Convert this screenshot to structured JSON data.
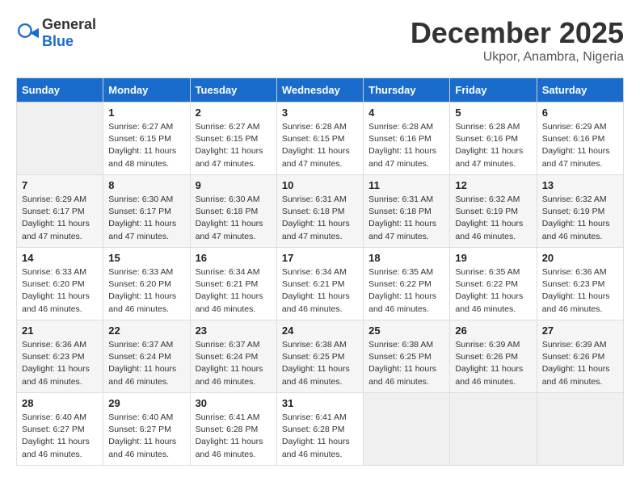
{
  "header": {
    "logo_general": "General",
    "logo_blue": "Blue",
    "month": "December 2025",
    "location": "Ukpor, Anambra, Nigeria"
  },
  "columns": [
    "Sunday",
    "Monday",
    "Tuesday",
    "Wednesday",
    "Thursday",
    "Friday",
    "Saturday"
  ],
  "weeks": [
    [
      {
        "day": "",
        "info": ""
      },
      {
        "day": "1",
        "info": "Sunrise: 6:27 AM\nSunset: 6:15 PM\nDaylight: 11 hours\nand 48 minutes."
      },
      {
        "day": "2",
        "info": "Sunrise: 6:27 AM\nSunset: 6:15 PM\nDaylight: 11 hours\nand 47 minutes."
      },
      {
        "day": "3",
        "info": "Sunrise: 6:28 AM\nSunset: 6:15 PM\nDaylight: 11 hours\nand 47 minutes."
      },
      {
        "day": "4",
        "info": "Sunrise: 6:28 AM\nSunset: 6:16 PM\nDaylight: 11 hours\nand 47 minutes."
      },
      {
        "day": "5",
        "info": "Sunrise: 6:28 AM\nSunset: 6:16 PM\nDaylight: 11 hours\nand 47 minutes."
      },
      {
        "day": "6",
        "info": "Sunrise: 6:29 AM\nSunset: 6:16 PM\nDaylight: 11 hours\nand 47 minutes."
      }
    ],
    [
      {
        "day": "7",
        "info": "Sunrise: 6:29 AM\nSunset: 6:17 PM\nDaylight: 11 hours\nand 47 minutes."
      },
      {
        "day": "8",
        "info": "Sunrise: 6:30 AM\nSunset: 6:17 PM\nDaylight: 11 hours\nand 47 minutes."
      },
      {
        "day": "9",
        "info": "Sunrise: 6:30 AM\nSunset: 6:18 PM\nDaylight: 11 hours\nand 47 minutes."
      },
      {
        "day": "10",
        "info": "Sunrise: 6:31 AM\nSunset: 6:18 PM\nDaylight: 11 hours\nand 47 minutes."
      },
      {
        "day": "11",
        "info": "Sunrise: 6:31 AM\nSunset: 6:18 PM\nDaylight: 11 hours\nand 47 minutes."
      },
      {
        "day": "12",
        "info": "Sunrise: 6:32 AM\nSunset: 6:19 PM\nDaylight: 11 hours\nand 46 minutes."
      },
      {
        "day": "13",
        "info": "Sunrise: 6:32 AM\nSunset: 6:19 PM\nDaylight: 11 hours\nand 46 minutes."
      }
    ],
    [
      {
        "day": "14",
        "info": "Sunrise: 6:33 AM\nSunset: 6:20 PM\nDaylight: 11 hours\nand 46 minutes."
      },
      {
        "day": "15",
        "info": "Sunrise: 6:33 AM\nSunset: 6:20 PM\nDaylight: 11 hours\nand 46 minutes."
      },
      {
        "day": "16",
        "info": "Sunrise: 6:34 AM\nSunset: 6:21 PM\nDaylight: 11 hours\nand 46 minutes."
      },
      {
        "day": "17",
        "info": "Sunrise: 6:34 AM\nSunset: 6:21 PM\nDaylight: 11 hours\nand 46 minutes."
      },
      {
        "day": "18",
        "info": "Sunrise: 6:35 AM\nSunset: 6:22 PM\nDaylight: 11 hours\nand 46 minutes."
      },
      {
        "day": "19",
        "info": "Sunrise: 6:35 AM\nSunset: 6:22 PM\nDaylight: 11 hours\nand 46 minutes."
      },
      {
        "day": "20",
        "info": "Sunrise: 6:36 AM\nSunset: 6:23 PM\nDaylight: 11 hours\nand 46 minutes."
      }
    ],
    [
      {
        "day": "21",
        "info": "Sunrise: 6:36 AM\nSunset: 6:23 PM\nDaylight: 11 hours\nand 46 minutes."
      },
      {
        "day": "22",
        "info": "Sunrise: 6:37 AM\nSunset: 6:24 PM\nDaylight: 11 hours\nand 46 minutes."
      },
      {
        "day": "23",
        "info": "Sunrise: 6:37 AM\nSunset: 6:24 PM\nDaylight: 11 hours\nand 46 minutes."
      },
      {
        "day": "24",
        "info": "Sunrise: 6:38 AM\nSunset: 6:25 PM\nDaylight: 11 hours\nand 46 minutes."
      },
      {
        "day": "25",
        "info": "Sunrise: 6:38 AM\nSunset: 6:25 PM\nDaylight: 11 hours\nand 46 minutes."
      },
      {
        "day": "26",
        "info": "Sunrise: 6:39 AM\nSunset: 6:26 PM\nDaylight: 11 hours\nand 46 minutes."
      },
      {
        "day": "27",
        "info": "Sunrise: 6:39 AM\nSunset: 6:26 PM\nDaylight: 11 hours\nand 46 minutes."
      }
    ],
    [
      {
        "day": "28",
        "info": "Sunrise: 6:40 AM\nSunset: 6:27 PM\nDaylight: 11 hours\nand 46 minutes."
      },
      {
        "day": "29",
        "info": "Sunrise: 6:40 AM\nSunset: 6:27 PM\nDaylight: 11 hours\nand 46 minutes."
      },
      {
        "day": "30",
        "info": "Sunrise: 6:41 AM\nSunset: 6:28 PM\nDaylight: 11 hours\nand 46 minutes."
      },
      {
        "day": "31",
        "info": "Sunrise: 6:41 AM\nSunset: 6:28 PM\nDaylight: 11 hours\nand 46 minutes."
      },
      {
        "day": "",
        "info": ""
      },
      {
        "day": "",
        "info": ""
      },
      {
        "day": "",
        "info": ""
      }
    ]
  ]
}
